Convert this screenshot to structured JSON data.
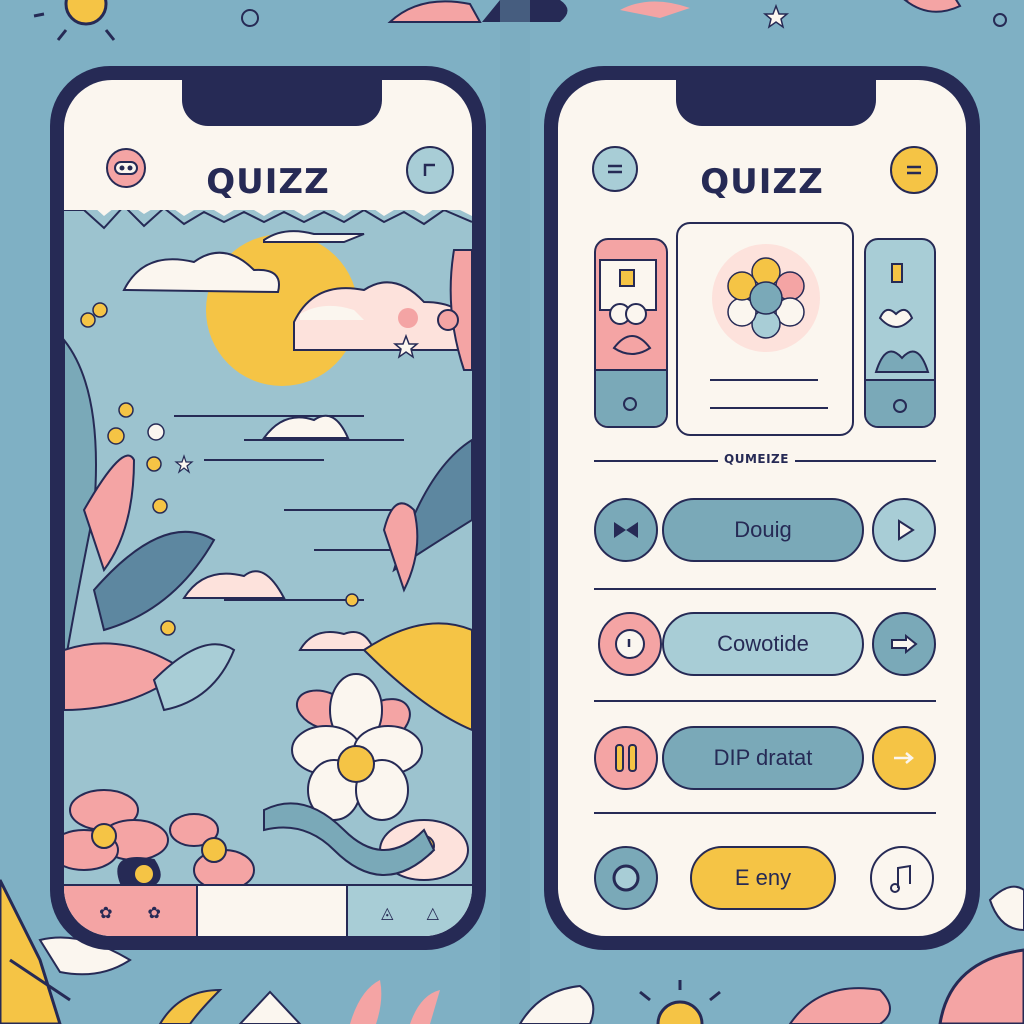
{
  "colors": {
    "background": "#7fb0c4",
    "frame": "#262a55",
    "screen": "#fbf6ef",
    "teal": "#7aa9b8",
    "pink": "#f4a4a4",
    "yellow": "#f5c445",
    "light_teal": "#a8cdd6"
  },
  "left_phone": {
    "title": "QUIZZ",
    "left_button_icon": "mask-icon",
    "right_button_icon": "corner-icon",
    "bottom_bar_icons": [
      "flower-icon",
      "flower-icon",
      "leaf-icon",
      "triangle-icon"
    ]
  },
  "right_phone": {
    "title": "QUIZZ",
    "left_button_icon": "menu-icon",
    "right_button_icon": "menu-icon",
    "section_label": "QUMEIZE",
    "options": [
      {
        "label": "Douig",
        "left_icon": "bow-icon",
        "right_icon": "play-icon"
      },
      {
        "label": "Cowotide",
        "left_icon": "record-icon",
        "right_icon": "arrow-right-icon"
      },
      {
        "label": "DIP dratat",
        "left_icon": "pause-icon",
        "right_icon": "arrow-right-icon"
      }
    ],
    "footer": {
      "label": "E eny",
      "left_icon": "circle-icon",
      "right_icon": "music-note-icon"
    }
  }
}
